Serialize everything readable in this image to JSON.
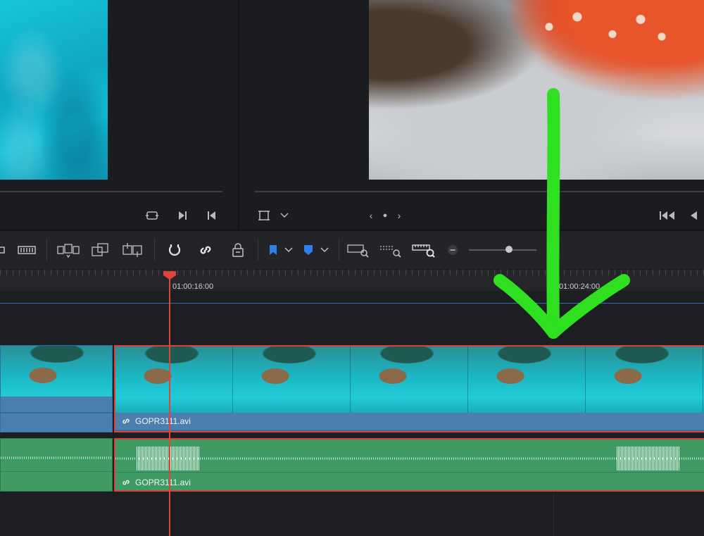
{
  "viewer": {
    "source": {
      "controls": [
        "loop-icon",
        "play-next-icon",
        "jump-prev-icon"
      ]
    },
    "timeline": {
      "controls": [
        "crop-icon",
        "chevron-down-icon"
      ],
      "nav": {
        "prev": "‹",
        "dot": "●",
        "next": "›"
      },
      "transport": [
        "rewind-start-icon",
        "play-reverse-icon"
      ]
    }
  },
  "toolbar": {
    "icons": [
      "edit-mode-icon",
      "trim-icon",
      "insert-clip-icon",
      "overwrite-clip-icon",
      "replace-clip-icon",
      "snapping-icon",
      "linked-selection-icon",
      "position-lock-icon",
      "flag-icon",
      "marker-icon",
      "zoom-full-icon",
      "zoom-detail-icon",
      "zoom-custom-icon"
    ],
    "accent_color": "#2f7fe8",
    "zoom_slider_level": 0.55
  },
  "timeline": {
    "timecodes": [
      "01:00:16:00",
      "01:00:24:00"
    ],
    "playhead_color": "#e0443a",
    "video_track": {
      "clips": [
        {
          "name": "",
          "selected": false
        },
        {
          "name": "GOPR3111.avi",
          "selected": true
        }
      ]
    },
    "audio_track": {
      "clips": [
        {
          "name": "",
          "selected": false
        },
        {
          "name": "GOPR3111.avi",
          "selected": true
        }
      ]
    }
  },
  "annotation": {
    "type": "arrow-down",
    "color": "#2ee01f"
  }
}
